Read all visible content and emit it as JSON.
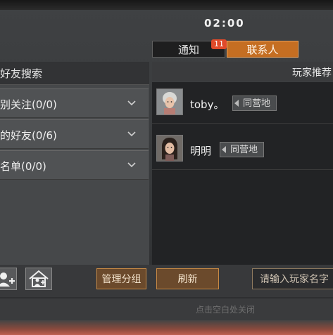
{
  "status": {
    "clock": "02:00"
  },
  "tabs": {
    "notify": {
      "label": "通知",
      "badge": "11"
    },
    "contacts": {
      "label": "联系人"
    }
  },
  "left": {
    "search_header": "好友搜索",
    "groups": [
      {
        "label": "别关注(0/0)"
      },
      {
        "label": "的好友(0/6)"
      },
      {
        "label": "名单(0/0)"
      }
    ],
    "manage_button": "管理分组"
  },
  "right": {
    "header": "玩家推荐",
    "friends": [
      {
        "name": "toby。",
        "tag": "同营地"
      },
      {
        "name": "明明",
        "tag": "同营地"
      }
    ],
    "refresh_button": "刷新",
    "search_placeholder": "请输入玩家名字"
  },
  "footer": {
    "close_hint": "点击空白处关闭"
  },
  "colors": {
    "accent": "#c56e22",
    "badge": "#e04a2a"
  },
  "icons": [
    "add-friend-icon",
    "add-group-icon",
    "chevron-down-icon"
  ]
}
